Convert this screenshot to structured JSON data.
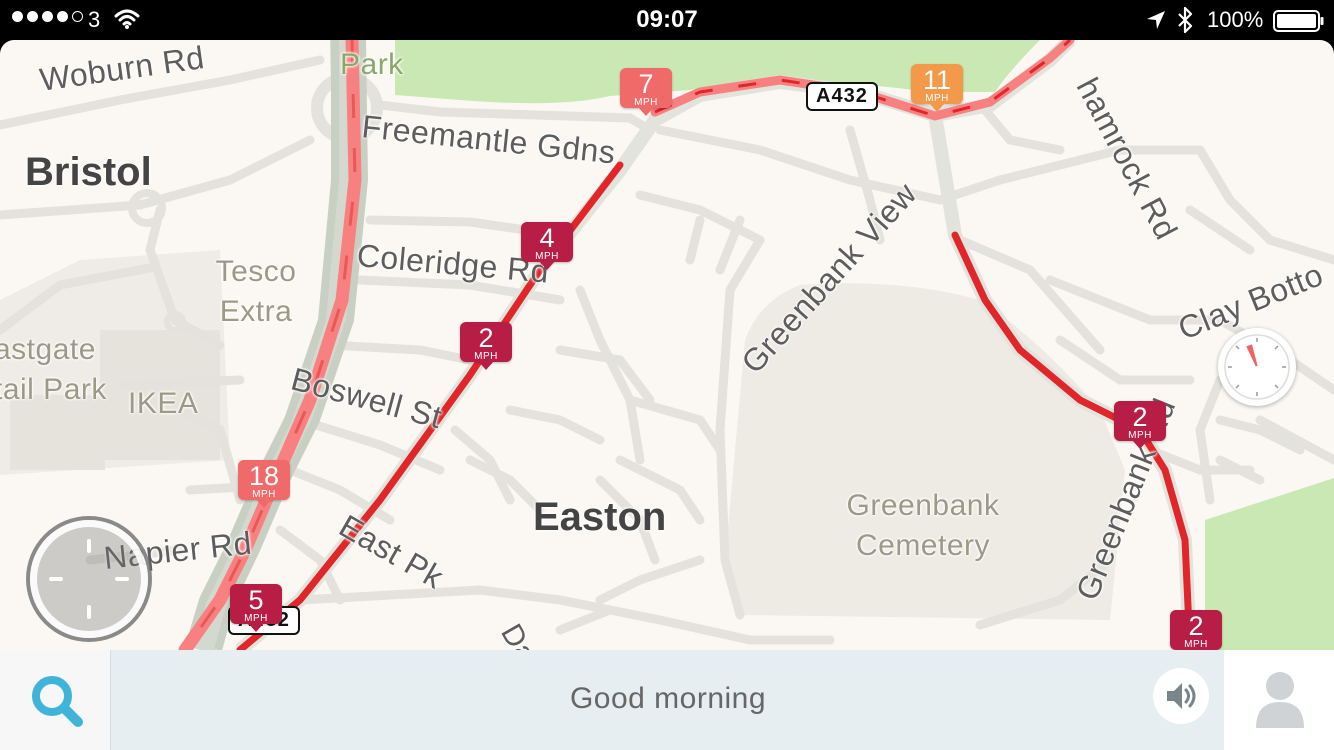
{
  "status_bar": {
    "carrier": "3",
    "time": "09:07",
    "battery": "100%",
    "icons": [
      "signal-dots-icon",
      "wifi-icon",
      "location-arrow-icon",
      "bluetooth-icon",
      "battery-icon"
    ]
  },
  "map": {
    "places": [
      "Bristol",
      "Easton"
    ],
    "streets": [
      "Woburn Rd",
      "Freemantle Gdns",
      "Coleridge Rd",
      "Boswell St",
      "East Pk",
      "Napier Rd",
      "Greenbank View",
      "hamrock Rd",
      "Clay Botto",
      "Greenbank Rd",
      "Dais"
    ],
    "pois": {
      "park": "Park",
      "tesco": "Tesco\nExtra",
      "eastgate": "astgate\ntail Park",
      "ikea": "IKEA",
      "cemetery": "Greenbank\nCemetery"
    },
    "road_shields": [
      "A432",
      "A432"
    ],
    "speed_unit": "MPH",
    "speed_markers": [
      {
        "value": "7",
        "color": "#f06a6a"
      },
      {
        "value": "11",
        "color": "#f39a4a"
      },
      {
        "value": "4",
        "color": "#b81e45"
      },
      {
        "value": "2",
        "color": "#b81e45"
      },
      {
        "value": "18",
        "color": "#f06a6a"
      },
      {
        "value": "5",
        "color": "#b81e45"
      },
      {
        "value": "2",
        "color": "#b81e45"
      },
      {
        "value": "2",
        "color": "#b81e45"
      }
    ],
    "colors": {
      "map_background": "#fbf8f3",
      "park_green": "#c9e8b4",
      "cemetery_gray": "#eeeae4",
      "road": "#e4e2dc",
      "traffic_red": "#e0262a",
      "traffic_light_red": "#f98080"
    }
  },
  "bottom_bar": {
    "greeting": "Good morning",
    "icons": [
      "search-icon",
      "speaker-icon",
      "profile-icon"
    ]
  }
}
